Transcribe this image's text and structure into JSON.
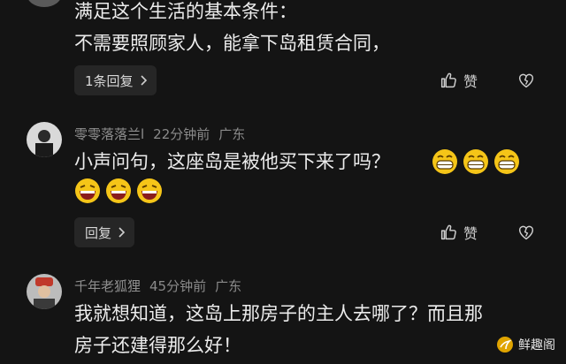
{
  "comment_top": {
    "line1": "满足这个生活的基本条件：",
    "line2": "不需要照顾家人，能拿下岛租赁合同，",
    "reply_count_label": "1条回复",
    "like_label": "赞"
  },
  "comment_2": {
    "author": "零零落落兰l",
    "time": "22分钟前",
    "location": "广东",
    "text": "小声问句，这座岛是被他买下来了吗？",
    "emoji_count_line1": 3,
    "emoji_count_line2": 3,
    "reply_label": "回复",
    "like_label": "赞"
  },
  "comment_3": {
    "author": "千年老狐狸",
    "time": "45分钟前",
    "location": "广东",
    "line1": "我就想知道，这岛上那房子的主人去哪了？而且那",
    "line2": "房子还建得那么好！"
  },
  "watermark": {
    "text": "鲜趣阁"
  }
}
